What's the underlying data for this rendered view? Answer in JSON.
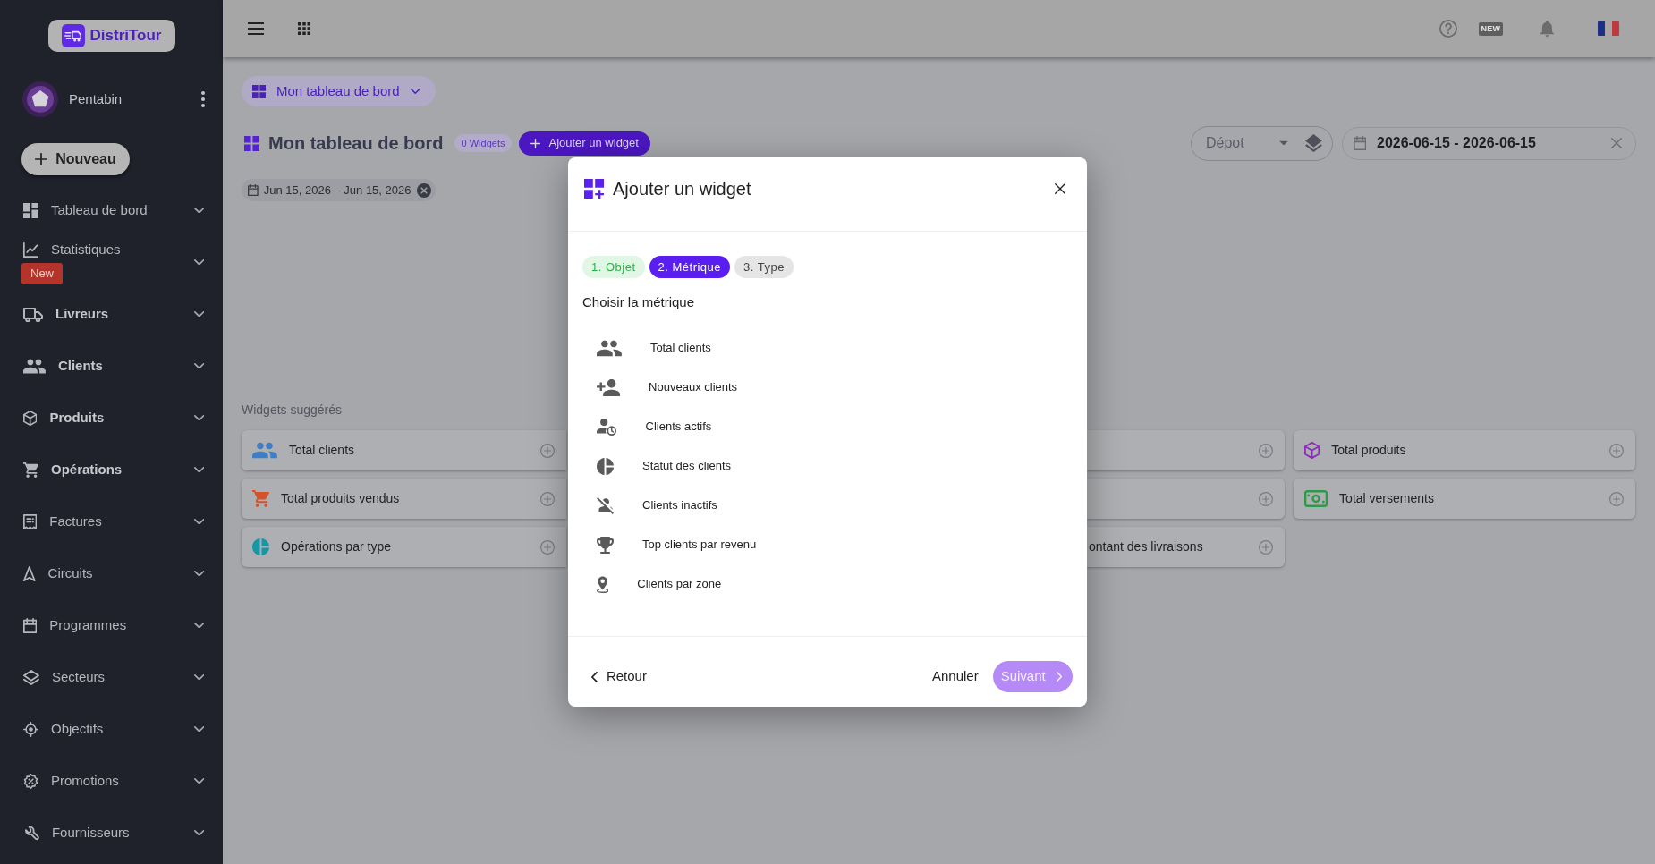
{
  "sidebar": {
    "brand": "DistriTour",
    "user": {
      "name": "Pentabin"
    },
    "new_button": "Nouveau",
    "items": [
      {
        "label": "Tableau de bord",
        "bold": false,
        "expanded": false
      },
      {
        "label": "Statistiques",
        "bold": false,
        "expanded": false,
        "badge": "New"
      },
      {
        "label": "Livreurs",
        "bold": true,
        "expanded": false
      },
      {
        "label": "Clients",
        "bold": true,
        "expanded": false
      },
      {
        "label": "Produits",
        "bold": true,
        "expanded": false
      },
      {
        "label": "Opérations",
        "bold": true,
        "expanded": false
      },
      {
        "label": "Factures",
        "bold": false,
        "expanded": false
      },
      {
        "label": "Circuits",
        "bold": false,
        "expanded": false
      },
      {
        "label": "Programmes",
        "bold": false,
        "expanded": false
      },
      {
        "label": "Secteurs",
        "bold": false,
        "expanded": false
      },
      {
        "label": "Objectifs",
        "bold": false,
        "expanded": false
      },
      {
        "label": "Promotions",
        "bold": false,
        "expanded": false
      },
      {
        "label": "Fournisseurs",
        "bold": false,
        "expanded": false
      }
    ]
  },
  "top_bar": {
    "whats_new": "NEW"
  },
  "dashboard": {
    "selector": "Mon tableau de bord",
    "title": "Mon tableau de bord",
    "widget_count": "0 Widgets",
    "add_button": "Ajouter un widget",
    "date_chip": "Jun 15, 2026 – Jun 15, 2026",
    "depot_select": {
      "placeholder": "Dépot"
    },
    "date_range": {
      "value": "2026-06-15 - 2026-06-15"
    }
  },
  "suggested_widgets": {
    "title": "Widgets suggérés",
    "columns": [
      [
        {
          "kind": "widget",
          "label": "Total clients",
          "color": "#3d7fc6"
        },
        {
          "kind": "widget",
          "label": "Total produits vendus",
          "color": "#d4522c"
        },
        {
          "kind": "widget",
          "label": "Opérations par type",
          "color": "#1597a6"
        }
      ],
      [
        {
          "kind": "covered"
        },
        {
          "kind": "covered"
        },
        {
          "kind": "covered",
          "label": "ontant des livraisons"
        }
      ],
      [
        {
          "kind": "widget",
          "label": "Total produits",
          "color": "#8b2fb5"
        },
        {
          "kind": "widget",
          "label": "Total versements",
          "color": "#2e9a48"
        }
      ]
    ]
  },
  "modal": {
    "title": "Ajouter un widget",
    "steps": [
      {
        "label": "1. Objet",
        "done": true,
        "selected": false
      },
      {
        "label": "2. Métrique",
        "done": false,
        "selected": true
      },
      {
        "label": "3. Type",
        "done": false,
        "selected": false
      }
    ],
    "prompt": "Choisir la métrique",
    "metrics": [
      {
        "label": "Total clients",
        "selected": false
      },
      {
        "label": "Nouveaux clients",
        "selected": false
      },
      {
        "label": "Clients actifs",
        "selected": false
      },
      {
        "label": "Statut des clients",
        "selected": false
      },
      {
        "label": "Clients inactifs",
        "selected": false
      },
      {
        "label": "Top clients par revenu",
        "selected": false
      },
      {
        "label": "Clients par zone",
        "selected": false
      }
    ],
    "back_button": "Retour",
    "cancel_button": "Annuler",
    "next_button": {
      "label": "Suivant",
      "disabled": true
    }
  }
}
